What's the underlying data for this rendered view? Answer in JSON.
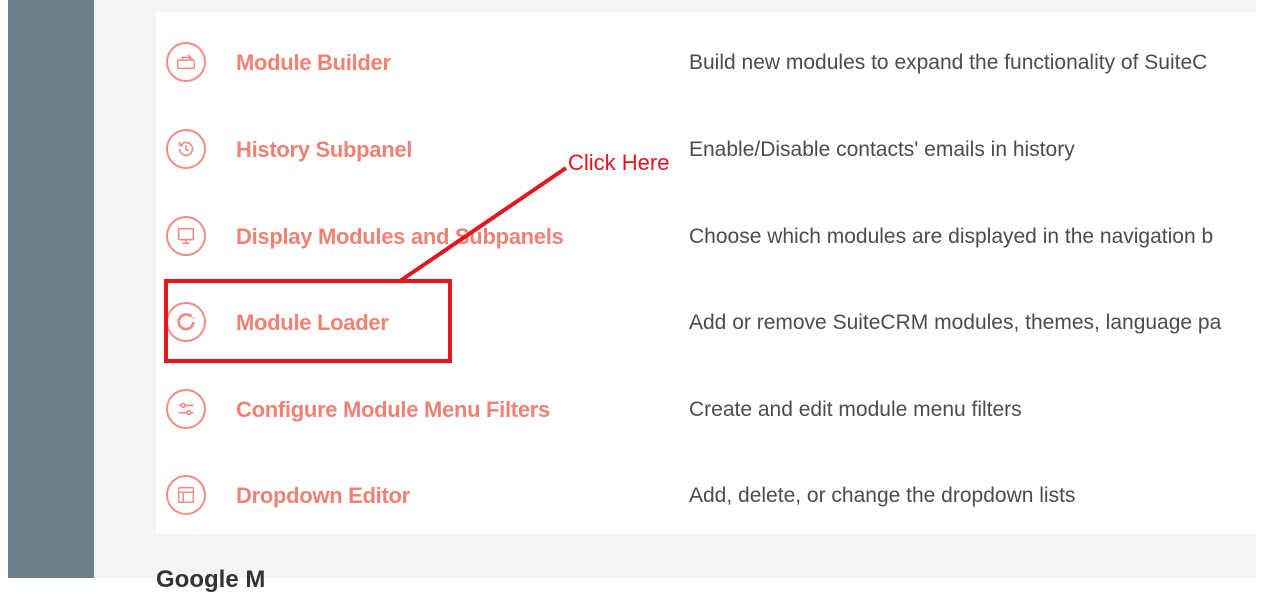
{
  "rows": [
    {
      "label": "Module Builder",
      "description": "Build new modules to expand the functionality of SuiteC",
      "icon": "toolbox-icon"
    },
    {
      "label": "History Subpanel",
      "description": "Enable/Disable contacts' emails in history",
      "icon": "history-icon"
    },
    {
      "label": "Display Modules and Subpanels",
      "description": "Choose which modules are displayed in the navigation b",
      "icon": "monitor-icon"
    },
    {
      "label": "Module Loader",
      "description": "Add or remove SuiteCRM modules, themes, language pa",
      "icon": "loader-icon"
    },
    {
      "label": "Configure Module Menu Filters",
      "description": "Create and edit module menu filters",
      "icon": "sliders-icon"
    },
    {
      "label": "Dropdown Editor",
      "description": "Add, delete, or change the dropdown lists",
      "icon": "layout-icon"
    }
  ],
  "annotation": {
    "text": "Click Here",
    "color": "#e3151f"
  },
  "bottom_heading": "Google M",
  "colors": {
    "link": "#f08275",
    "sidebar": "#6b7f8d",
    "annotation": "#e3151f"
  }
}
